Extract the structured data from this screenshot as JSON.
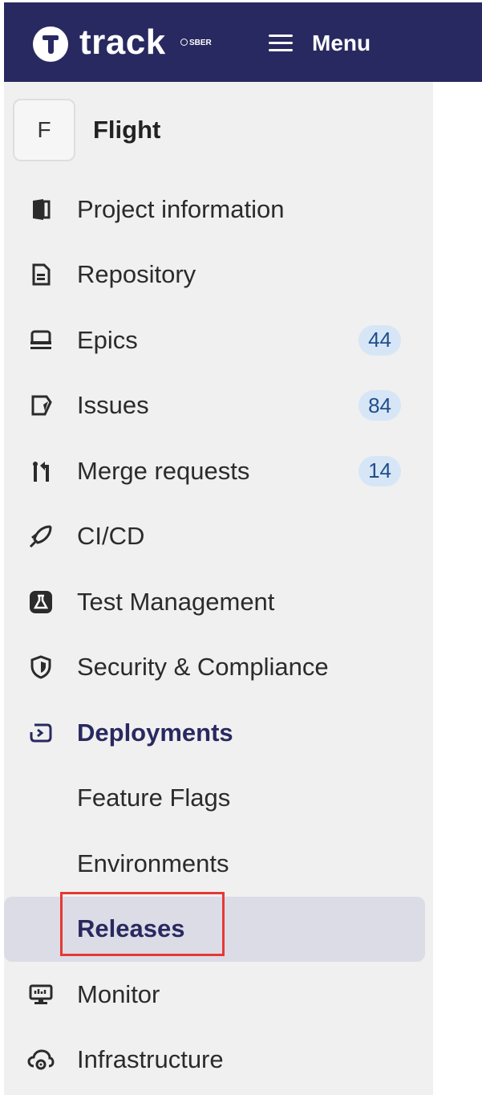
{
  "header": {
    "logo_text": "track",
    "logo_sub": "SBER",
    "menu_label": "Menu"
  },
  "project": {
    "avatar_letter": "F",
    "name": "Flight"
  },
  "nav": {
    "items": [
      {
        "label": "Project information",
        "icon": "project-information-icon"
      },
      {
        "label": "Repository",
        "icon": "repository-icon"
      },
      {
        "label": "Epics",
        "icon": "epics-icon",
        "badge": "44"
      },
      {
        "label": "Issues",
        "icon": "issues-icon",
        "badge": "84"
      },
      {
        "label": "Merge requests",
        "icon": "merge-request-icon",
        "badge": "14"
      },
      {
        "label": "CI/CD",
        "icon": "rocket-icon"
      },
      {
        "label": "Test Management",
        "icon": "flask-icon"
      },
      {
        "label": "Security & Compliance",
        "icon": "shield-icon"
      },
      {
        "label": "Deployments",
        "icon": "deployments-icon",
        "active": true
      },
      {
        "label": "Feature Flags",
        "sub": true
      },
      {
        "label": "Environments",
        "sub": true
      },
      {
        "label": "Releases",
        "sub": true,
        "selected": true
      },
      {
        "label": "Monitor",
        "icon": "monitor-icon"
      },
      {
        "label": "Infrastructure",
        "icon": "cloud-gear-icon"
      }
    ]
  },
  "colors": {
    "header_bg": "#292961",
    "sidebar_bg": "#f0f0f0",
    "badge_bg": "#d6e6f7",
    "badge_text": "#1f4e8a",
    "highlight": "#e53935",
    "active_text": "#292961"
  }
}
